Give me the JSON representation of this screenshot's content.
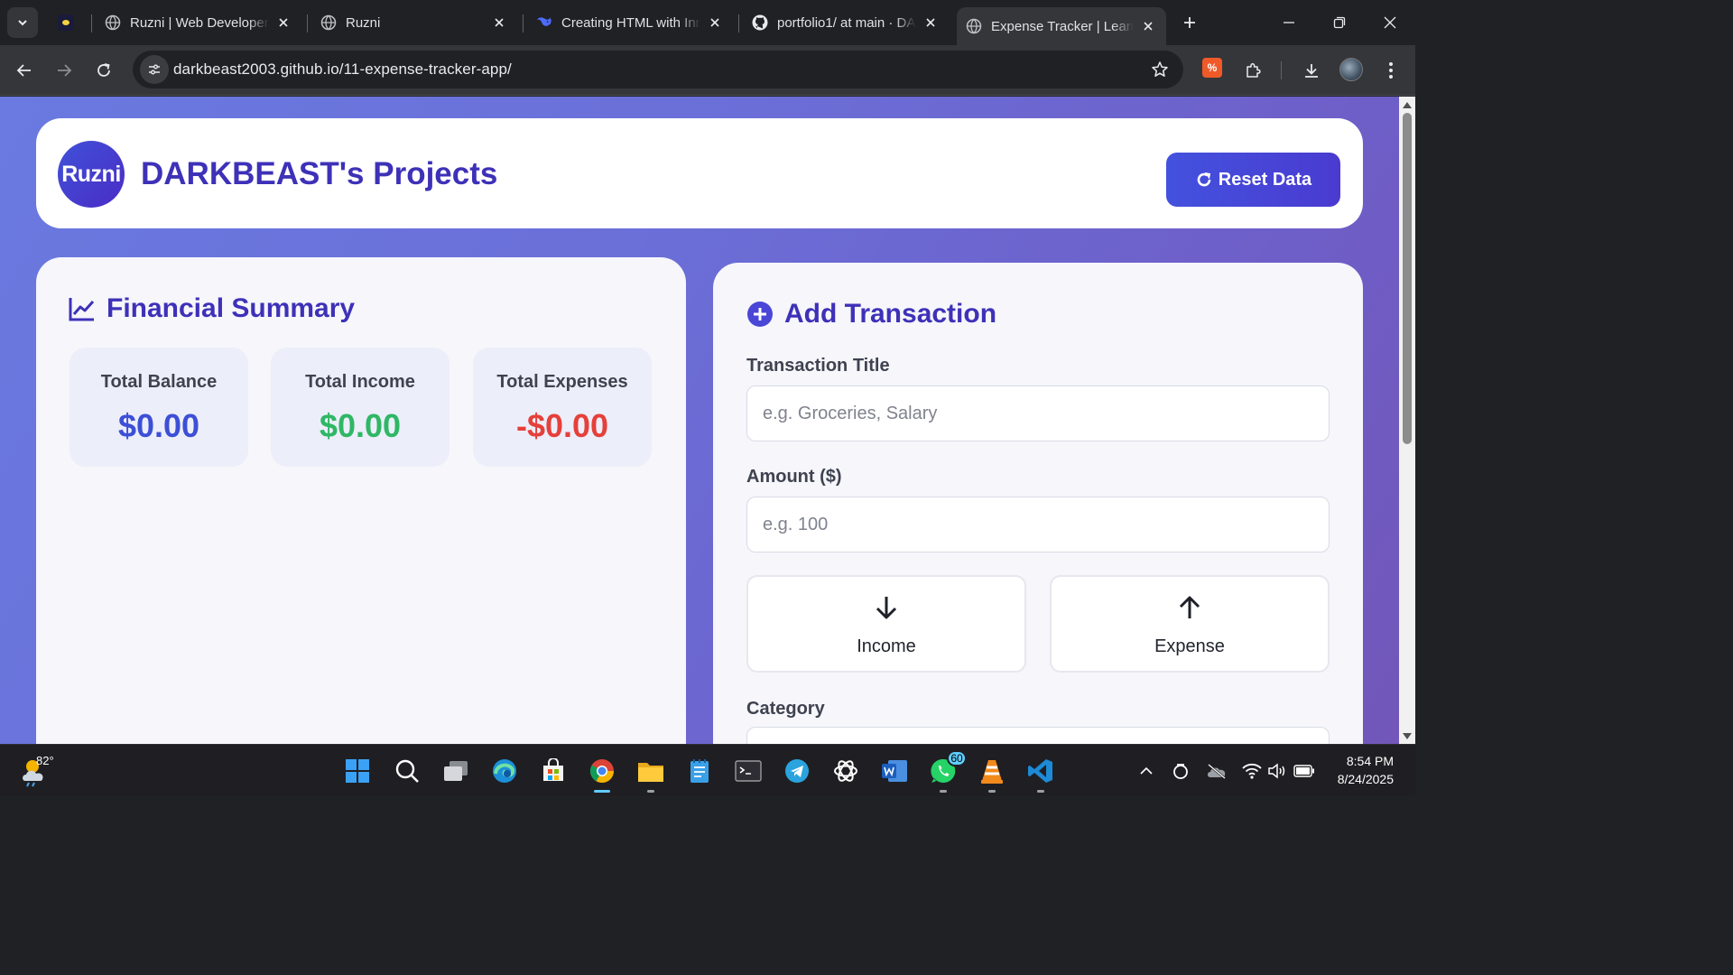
{
  "browser": {
    "tabs": [
      {
        "title": "Ruzni | Web Developer",
        "icon": "globe-icon"
      },
      {
        "title": "Ruzni",
        "icon": "globe-icon"
      },
      {
        "title": "Creating HTML with Inn",
        "icon": "deepseek-icon"
      },
      {
        "title": "portfolio1/ at main · DA",
        "icon": "github-icon"
      },
      {
        "title": "Expense Tracker | Learn",
        "icon": "globe-icon",
        "active": true
      }
    ],
    "url": "darkbeast2003.github.io/11-expense-tracker-app/"
  },
  "page": {
    "logo_text": "Ruzni",
    "site_title": "DARKBEAST's Projects",
    "reset_label": "Reset Data",
    "summary": {
      "title": "Financial Summary",
      "balance_label": "Total Balance",
      "balance_value": "$0.00",
      "income_label": "Total Income",
      "income_value": "$0.00",
      "expense_label": "Total Expenses",
      "expense_value": "-$0.00"
    },
    "form": {
      "title": "Add Transaction",
      "title_label": "Transaction Title",
      "title_placeholder": "e.g. Groceries, Salary",
      "amount_label": "Amount ($)",
      "amount_placeholder": "e.g. 100",
      "income_label": "Income",
      "expense_label": "Expense",
      "category_label": "Category"
    },
    "colors": {
      "accent": "#3e31b8",
      "balance": "#3d4fd6",
      "income": "#2fb765",
      "expense": "#e5403a"
    }
  },
  "taskbar": {
    "temperature": "82°",
    "whatsapp_badge": "60",
    "time": "8:54 PM",
    "date": "8/24/2025"
  }
}
